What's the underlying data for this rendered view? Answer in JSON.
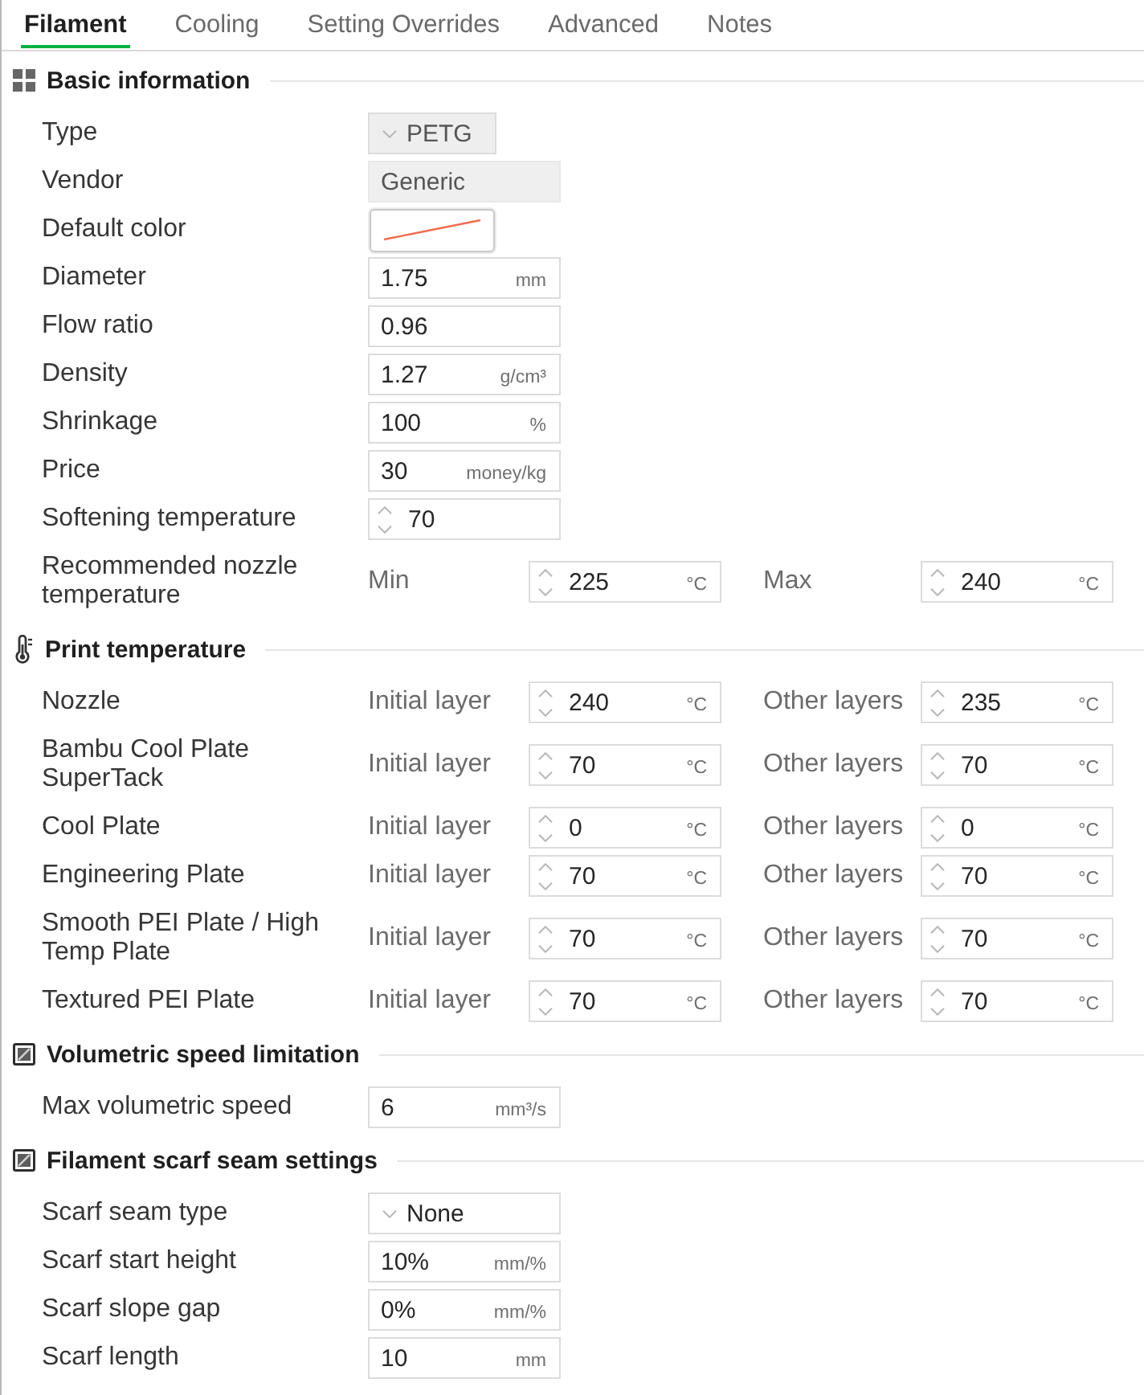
{
  "tabs": [
    {
      "label": "Filament",
      "selected": true
    },
    {
      "label": "Cooling",
      "selected": false
    },
    {
      "label": "Setting Overrides",
      "selected": false
    },
    {
      "label": "Advanced",
      "selected": false
    },
    {
      "label": "Notes",
      "selected": false
    }
  ],
  "sections": [
    {
      "title": "Basic information",
      "rows": [
        {
          "kind": "dropdown",
          "label": "Type",
          "value": "PETG",
          "disabled": true
        },
        {
          "kind": "text",
          "label": "Vendor",
          "value": "Generic",
          "disabled": true
        },
        {
          "kind": "color",
          "label": "Default color"
        },
        {
          "kind": "text",
          "label": "Diameter",
          "value": "1.75",
          "unit": "mm",
          "disabled": false
        },
        {
          "kind": "text",
          "label": "Flow ratio",
          "value": "0.96",
          "disabled": false
        },
        {
          "kind": "text",
          "label": "Density",
          "value": "1.27",
          "unit": "g/cm³",
          "disabled": false
        },
        {
          "kind": "text",
          "label": "Shrinkage",
          "value": "100",
          "unit": "%",
          "disabled": false
        },
        {
          "kind": "text",
          "label": "Price",
          "value": "30",
          "unit": "money/kg",
          "disabled": false
        },
        {
          "kind": "spin",
          "label": "Softening temperature",
          "value": "70"
        },
        {
          "kind": "pair",
          "label": "Recommended nozzle temperature",
          "fields": [
            {
              "label": "Min",
              "value": "225",
              "unit": "°C"
            },
            {
              "label": "Max",
              "value": "240",
              "unit": "°C"
            }
          ]
        }
      ]
    },
    {
      "title": "Print temperature",
      "rows": [
        {
          "kind": "pair",
          "label": "Nozzle",
          "fields": [
            {
              "label": "Initial layer",
              "value": "240",
              "unit": "°C"
            },
            {
              "label": "Other layers",
              "value": "235",
              "unit": "°C"
            }
          ]
        },
        {
          "kind": "pair",
          "label": "Bambu Cool Plate SuperTack",
          "fields": [
            {
              "label": "Initial layer",
              "value": "70",
              "unit": "°C"
            },
            {
              "label": "Other layers",
              "value": "70",
              "unit": "°C"
            }
          ]
        },
        {
          "kind": "pair",
          "label": "Cool Plate",
          "fields": [
            {
              "label": "Initial layer",
              "value": "0",
              "unit": "°C"
            },
            {
              "label": "Other layers",
              "value": "0",
              "unit": "°C"
            }
          ]
        },
        {
          "kind": "pair",
          "label": "Engineering Plate",
          "fields": [
            {
              "label": "Initial layer",
              "value": "70",
              "unit": "°C"
            },
            {
              "label": "Other layers",
              "value": "70",
              "unit": "°C"
            }
          ]
        },
        {
          "kind": "pair",
          "label": "Smooth PEI Plate / High Temp Plate",
          "fields": [
            {
              "label": "Initial layer",
              "value": "70",
              "unit": "°C"
            },
            {
              "label": "Other layers",
              "value": "70",
              "unit": "°C"
            }
          ]
        },
        {
          "kind": "pair",
          "label": "Textured PEI Plate",
          "fields": [
            {
              "label": "Initial layer",
              "value": "70",
              "unit": "°C"
            },
            {
              "label": "Other layers",
              "value": "70",
              "unit": "°C"
            }
          ]
        }
      ]
    },
    {
      "title": "Volumetric speed limitation",
      "rows": [
        {
          "kind": "text",
          "label": "Max volumetric speed",
          "value": "6",
          "unit": "mm³/s",
          "disabled": false
        }
      ]
    },
    {
      "title": "Filament scarf seam settings",
      "rows": [
        {
          "kind": "dropdown",
          "label": "Scarf seam type",
          "value": "None",
          "disabled": false
        },
        {
          "kind": "text",
          "label": "Scarf start height",
          "value": "10%",
          "unit": "mm/%",
          "disabled": false
        },
        {
          "kind": "text",
          "label": "Scarf slope gap",
          "value": "0%",
          "unit": "mm/%",
          "disabled": false
        },
        {
          "kind": "text",
          "label": "Scarf length",
          "value": "10",
          "unit": "mm",
          "disabled": false
        }
      ]
    }
  ]
}
